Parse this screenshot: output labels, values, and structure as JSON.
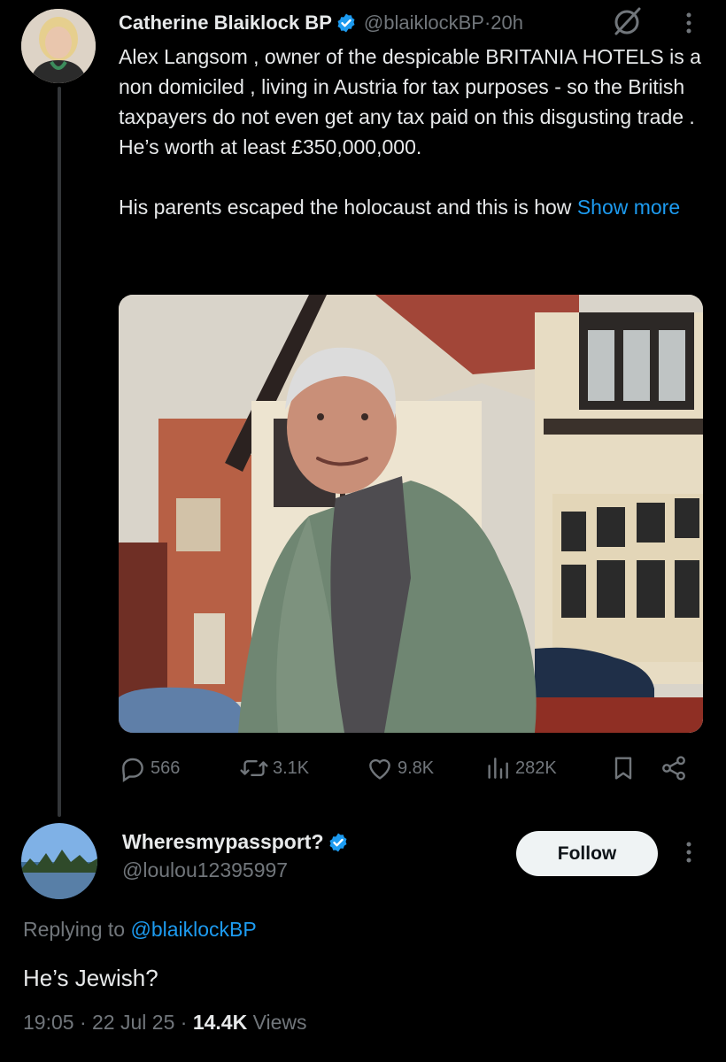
{
  "tweet": {
    "author_name": "Catherine Blaiklock BP",
    "handle": "@blaiklockBP",
    "separator": " · ",
    "time": "20h",
    "text": "Alex Langsom , owner of the despicable BRITANIA HOTELS is a non domiciled , living in Austria for tax purposes - so the British taxpayers do not even get any tax paid on this disgusting trade . He’s worth at least £350,000,000.\n\nHis parents escaped the holocaust and this is how ",
    "show_more": "Show more",
    "stats": {
      "replies": "566",
      "reposts": "3.1K",
      "likes": "9.8K",
      "views": "282K"
    },
    "icons": [
      "verified-badge-icon",
      "grok-icon",
      "more-icon",
      "reply-icon",
      "repost-icon",
      "like-icon",
      "views-icon",
      "bookmark-icon",
      "share-icon"
    ]
  },
  "reply": {
    "author_name": "Wheresmypassport?",
    "handle": "@loulou12395997",
    "follow_label": "Follow",
    "replying_prefix": "Replying to ",
    "replying_to": "@blaiklockBP",
    "text": "He’s Jewish?",
    "time": "19:05",
    "date": "22 Jul 25",
    "views_count": "14.4K",
    "views_label": "Views",
    "dot": " · "
  },
  "colors": {
    "background": "#000000",
    "text": "#e7e9ea",
    "secondary": "#71767b",
    "accent": "#1d9bf0",
    "thread_line": "#333639"
  }
}
